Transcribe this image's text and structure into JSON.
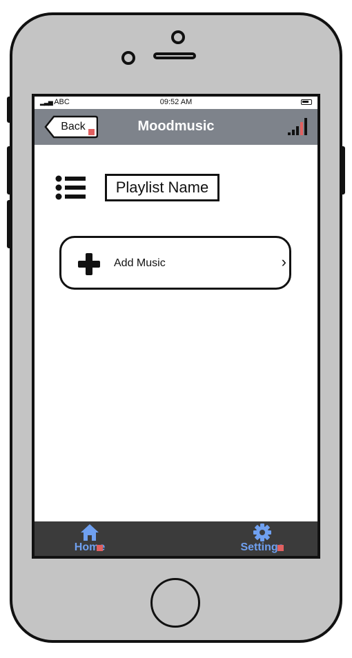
{
  "status_bar": {
    "carrier": "ABC",
    "time": "09:52 AM"
  },
  "nav": {
    "back_label": "Back",
    "title": "Moodmusic"
  },
  "content": {
    "playlist_name": "Playlist Name",
    "add_music_label": "Add Music",
    "chevron": "›"
  },
  "tabs": [
    {
      "label": "Home",
      "icon": "home-icon"
    },
    {
      "label": "Settings",
      "icon": "gear-icon"
    }
  ],
  "colors": {
    "nav_bar": "#7e838b",
    "tab_bar": "#3b3b3b",
    "tab_label": "#6fa0f0",
    "phone_body": "#c4c4c4",
    "marker": "#e06060"
  }
}
